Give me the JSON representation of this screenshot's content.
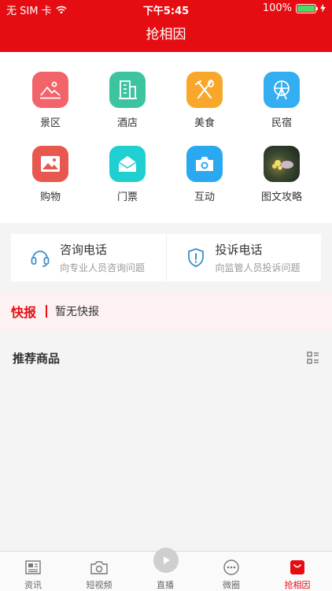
{
  "status_bar": {
    "carrier": "无 SIM 卡",
    "time": "下午5:45",
    "battery": "100%"
  },
  "header": {
    "title": "抢相因"
  },
  "categories": [
    {
      "label": "景区",
      "icon": "landscape-icon",
      "color": "#f2636a"
    },
    {
      "label": "酒店",
      "icon": "building-icon",
      "color": "#3cc4a0"
    },
    {
      "label": "美食",
      "icon": "utensils-icon",
      "color": "#f9a72b"
    },
    {
      "label": "民宿",
      "icon": "ferris-wheel-icon",
      "color": "#33aef0"
    },
    {
      "label": "购物",
      "icon": "image-icon",
      "color": "#e8584f"
    },
    {
      "label": "门票",
      "icon": "envelope-icon",
      "color": "#1fcfd1"
    },
    {
      "label": "互动",
      "icon": "camera-icon",
      "color": "#2aa8f0"
    },
    {
      "label": "图文攻略",
      "icon": "guide-thumbnail-icon",
      "color": "#2d3b2a"
    }
  ],
  "phones": [
    {
      "title": "咨询电话",
      "subtitle": "向专业人员咨询问题",
      "icon": "headset-icon"
    },
    {
      "title": "投诉电话",
      "subtitle": "向监管人员投诉问题",
      "icon": "shield-alert-icon"
    }
  ],
  "news": {
    "tag": "快报",
    "message": "暂无快报"
  },
  "recommend": {
    "title": "推荐商品"
  },
  "tabs": [
    {
      "label": "资讯",
      "icon": "newspaper-icon"
    },
    {
      "label": "短视频",
      "icon": "camera-outline-icon"
    },
    {
      "label": "直播",
      "icon": "play-icon"
    },
    {
      "label": "微圈",
      "icon": "chat-bubble-icon"
    },
    {
      "label": "抢相因",
      "icon": "shopping-bag-icon"
    }
  ],
  "colors": {
    "brand": "#e60d12",
    "battery": "#4cd964"
  }
}
